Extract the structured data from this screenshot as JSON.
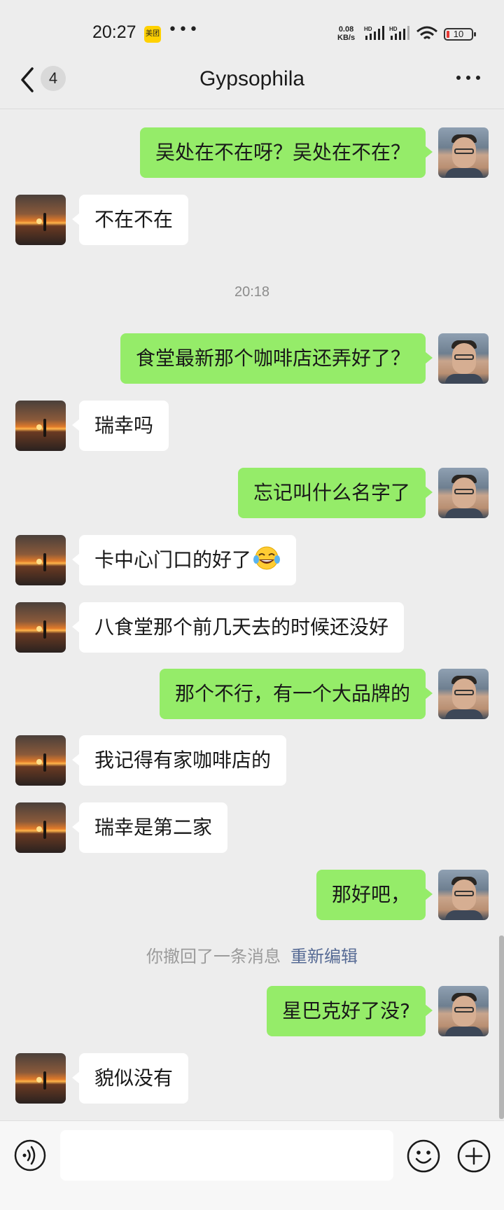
{
  "status_bar": {
    "time": "20:27",
    "app_badge": "美团",
    "more": "•••",
    "net_speed_value": "0.08",
    "net_speed_unit": "KB/s",
    "sim_label": "HD",
    "battery_level": "10",
    "battery_color": "#e53935"
  },
  "nav": {
    "back_icon": "chevron-left-icon",
    "unread_count": "4",
    "title": "Gypsophila",
    "more_icon": "more-horizontal-icon"
  },
  "messages": [
    {
      "side": "self",
      "text": "吴处在不在呀？吴处在不在？"
    },
    {
      "side": "other",
      "text": "不在不在"
    },
    {
      "side": "self",
      "text": "食堂最新那个咖啡店还弄好了？"
    },
    {
      "side": "other",
      "text": "瑞幸吗"
    },
    {
      "side": "self",
      "text": "忘记叫什么名字了"
    },
    {
      "side": "other",
      "text": "卡中心门口的好了",
      "emoji": "tears-of-joy-emoji"
    },
    {
      "side": "other",
      "text": "八食堂那个前几天去的时候还没好"
    },
    {
      "side": "self",
      "text": "那个不行，有一个大品牌的"
    },
    {
      "side": "other",
      "text": "我记得有家咖啡店的"
    },
    {
      "side": "other",
      "text": "瑞幸是第二家"
    },
    {
      "side": "self",
      "text": "那好吧，"
    },
    {
      "side": "self",
      "text": "星巴克好了没?"
    },
    {
      "side": "other",
      "text": "貌似没有"
    }
  ],
  "timestamp": "20:18",
  "recall": {
    "text": "你撤回了一条消息",
    "edit_label": "重新编辑"
  },
  "input_bar": {
    "voice_icon": "voice-icon",
    "input_value": "",
    "emoji_icon": "smiley-icon",
    "add_icon": "plus-circle-icon"
  },
  "colors": {
    "self_bubble": "#95ec69",
    "other_bubble": "#ffffff",
    "background": "#ededed",
    "link": "#576b95"
  }
}
